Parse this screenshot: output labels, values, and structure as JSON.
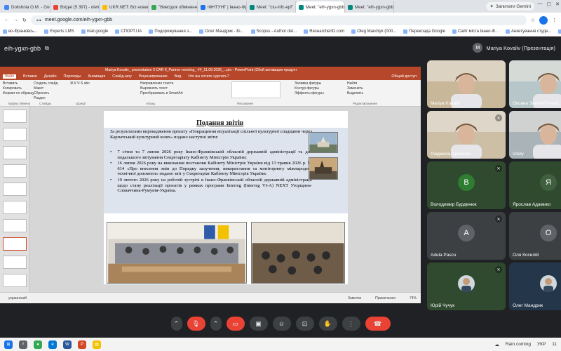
{
  "browser": {
    "tabs": [
      {
        "label": "Dolishnia O.M. - Google A",
        "color": "#4285f4",
        "active": false
      },
      {
        "label": "Вхідні (5 397) - oleh.mand",
        "color": "#ea4335",
        "active": false
      },
      {
        "label": "UKR.NET: Всі новини Украї",
        "color": "#fbbc04",
        "active": false
      },
      {
        "label": "\"Вивсідок обміняння Д",
        "color": "#34a853",
        "active": false
      },
      {
        "label": "ІФНТУНГ | Івано-Франківсь",
        "color": "#1a73e8",
        "active": false
      },
      {
        "label": "Meet: \"ciu-mfc-epf\"",
        "color": "#00897b",
        "active": false
      },
      {
        "label": "Meet: \"eih-ygxn-gbb\"",
        "color": "#00897b",
        "active": true
      },
      {
        "label": "Meet: \"eih-ygxn-gbb\"",
        "color": "#00897b",
        "active": false
      }
    ],
    "gemini_label": "Запитати Gemini",
    "url": "meet.google.com/eih-ygxn-gbb",
    "bookmarks": [
      "во-Франківсь...",
      "Experts LMS",
      "mail.google",
      "СПОРТ.UA",
      "Подорожування з...",
      "Олег Мандрик - Бі...",
      "Scopus - Author det...",
      "ResearcherID.com",
      "Oleg Mandryk (000...",
      "Переклада Google",
      "Сайт міста Івано-Ф...",
      "Анкетування студе...",
      "Усі закладки"
    ]
  },
  "meet": {
    "code": "eih-ygxn-gbb",
    "presenter_label": "Mariya Kovaliv (Презентація)",
    "presenter_initial": "M"
  },
  "ppt": {
    "window_title": "Mariya Kovaliv_ presentation II CAR II_Partner meeting_ #4_11.09.2026_...ptx - PowerPoint (Сбой активации продукт",
    "menu": [
      "Файл",
      "Вставка",
      "Дизайн",
      "Переходы",
      "Анимация",
      "Слайд-шоу",
      "Рецензирование",
      "Вид",
      "Что вы хотите сделать?"
    ],
    "menu_selected": "Файл",
    "share_label": "Общий доступ",
    "ribbon_groups": [
      {
        "lines": [
          "Вставить",
          "Копировать",
          "Формат по образцу"
        ],
        "label": "Буфер обмена"
      },
      {
        "lines": [
          "Создать слайд",
          "Макет",
          "Сбросить",
          "Раздел"
        ],
        "label": "Слайды"
      },
      {
        "lines": [
          "",
          "Ж К Ч S abc",
          ""
        ],
        "label": "Шрифт"
      },
      {
        "lines": [
          "",
          "Направление текста",
          "Выровнять текст",
          "Преобразовать в SmartArt"
        ],
        "label": "Абзац"
      },
      {
        "lines": [
          "",
          "Упорядочить",
          "Экспресс-стили"
        ],
        "label": "Рисование"
      },
      {
        "lines": [
          "Заливка фигуры",
          "Контур фигуры",
          "Эффекты фигуры"
        ],
        "label": ""
      },
      {
        "lines": [
          "Найти",
          "Заменить",
          "Выделить"
        ],
        "label": "Редактирование"
      }
    ],
    "slide_title": "Подання звітів",
    "slide_intro": "За результатами впровадження проєкту «Покращення візуалізації спільної культурної спадщини через Карпатський культурний шлях» подано наступні звіти:",
    "bullets": [
      "7 січня та 7 липня 2026 року Івано-Франківській обласній державній адміністрації та для подальшого звітування Секретаріату Кабінету Міністрів України;",
      "16 липня 2026 року на виконання постанови Кабінету Міністрів України від 13 травня 2026 р. № 614 «Про внесення змін до Порядку залучення, використання та моніторингу міжнародної технічної допомоги» подано звіт у Секретаріат Кабінету Міністрів України.",
      "19 лютого 2026 року на робочій зустрічі в Івано-Франківській обласній державній адміністрації щодо стану реалізації проєктів у рамках програми Interreg (Interreg VI-A) NEXT Угорщина-Словаччина-Румунія-Україна."
    ],
    "bullet_glyph": "•",
    "status_lang": "украинский",
    "status_notes": "Заметки",
    "status_comments": "Примечания",
    "zoom": "74%"
  },
  "participants": [
    {
      "name": "Mariya Kovaliv",
      "type": "video",
      "bg": "#c9b79a",
      "mic_off": false
    },
    {
      "name": "Оксана Senkiv-Fertedi",
      "type": "video",
      "bg": "#b7c7c9",
      "mic_off": false
    },
    {
      "name": "Людмила Архипюк",
      "type": "video",
      "bg": "#cdbfa6",
      "mic_off": true
    },
    {
      "name": "Vitaly",
      "type": "video",
      "bg": "#a9b3b8",
      "mic_off": true
    },
    {
      "name": "Володимир Бурденюк",
      "type": "avatar",
      "initial": "В",
      "avatar_color": "#2e7d32",
      "tile_color": "#2f4a2f",
      "mic_off": true
    },
    {
      "name": "Ярослав Адамико",
      "type": "avatar",
      "initial": "Я",
      "avatar_color": "#3f5f3f",
      "tile_color": "#2f4a2f",
      "mic_off": true
    },
    {
      "name": "Adela Pascu",
      "type": "avatar",
      "initial": "A",
      "avatar_color": "#5f6368",
      "tile_color": "#3c4043",
      "mic_off": true
    },
    {
      "name": "Оля Косилій",
      "type": "avatar",
      "initial": "O",
      "avatar_color": "#5f6368",
      "tile_color": "#3c4043",
      "mic_off": true
    },
    {
      "name": "Юрій Чучук",
      "type": "avatar-photo",
      "bg": "#2f4a2f",
      "mic_off": true
    },
    {
      "name": "Олег Мандрик",
      "type": "avatar-photo",
      "bg": "#24364a",
      "mic_off": true
    }
  ],
  "taskbar": {
    "weather": "Rain coming",
    "lang": "УКР",
    "time": "11"
  }
}
